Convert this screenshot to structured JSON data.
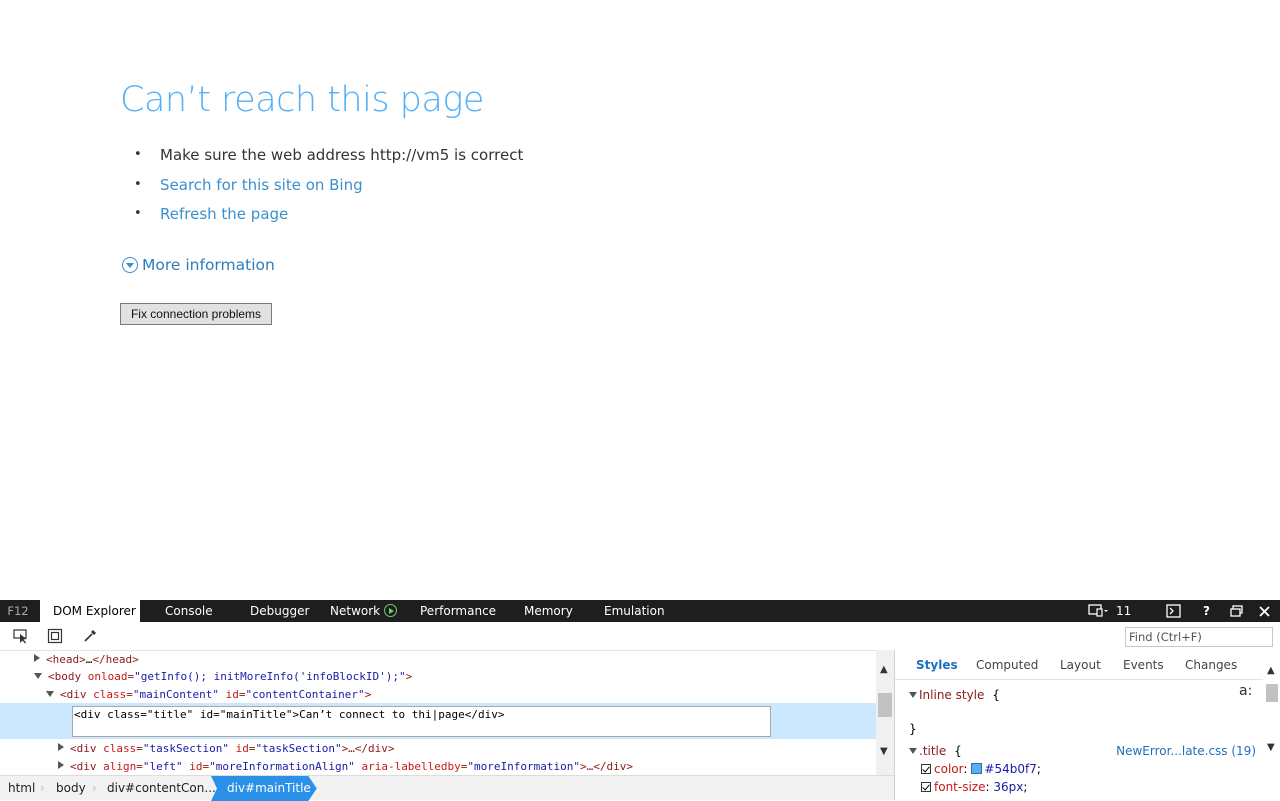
{
  "error_page": {
    "title": "Can’t reach this page",
    "tasks": [
      {
        "text": "Make sure the web address http://vm5 is correct",
        "link": false
      },
      {
        "text": "Search for this site on Bing",
        "link": true
      },
      {
        "text": "Refresh the page",
        "link": true
      }
    ],
    "more_info_label": "More information",
    "fix_button_label": "Fix connection problems"
  },
  "devtools": {
    "f12_label": "F12",
    "tabs": [
      "DOM Explorer",
      "Console",
      "Debugger",
      "Network",
      "Performance",
      "Memory",
      "Emulation"
    ],
    "active_tab": "DOM Explorer",
    "document_mode": "11",
    "find_placeholder": "Find (Ctrl+F)",
    "dom_lines": {
      "head": {
        "tag_open": "<head>",
        "ellipsis": "…",
        "tag_close": "</head>"
      },
      "body": {
        "tag": "<body ",
        "attr1": "onload",
        "val1": "\"getInfo(); initMoreInfo('infoBlockID');\"",
        "end": ">"
      },
      "main": {
        "tag": "<div ",
        "attr1": "class",
        "val1": "\"mainContent\"",
        "attr2": "id",
        "val2": "\"contentContainer\"",
        "end": ">"
      },
      "edit_text": "<div class=\"title\" id=\"mainTitle\">Can’t connect to thi|page</div>",
      "task": {
        "tag": "<div ",
        "attr1": "class",
        "val1": "\"taskSection\"",
        "attr2": "id",
        "val2": "\"taskSection\"",
        "end": ">…</div>"
      },
      "more": {
        "tag": "<div ",
        "attr1": "align",
        "val1": "\"left\"",
        "attr2": "id",
        "val2": "\"moreInformationAlign\"",
        "attr3": "aria-labelledby",
        "val3": "\"moreInformation\"",
        "end": ">…</div>"
      }
    },
    "breadcrumbs": [
      "html",
      "body",
      "div#contentCon...",
      "div#mainTitle"
    ],
    "styles_tabs": [
      "Styles",
      "Computed",
      "Layout",
      "Events",
      "Changes"
    ],
    "styles": {
      "inline_label": "Inline style",
      "inline_open": "{",
      "inline_close": "}",
      "rule_selector": ".title",
      "rule_open": "{",
      "source": "NewError...late.css (19)",
      "props": [
        {
          "name": "color",
          "value": "#54b0f7",
          "swatch": "#54b0f7"
        },
        {
          "name": "font-size",
          "value": "36px"
        }
      ],
      "font_toggle": "a:"
    }
  }
}
